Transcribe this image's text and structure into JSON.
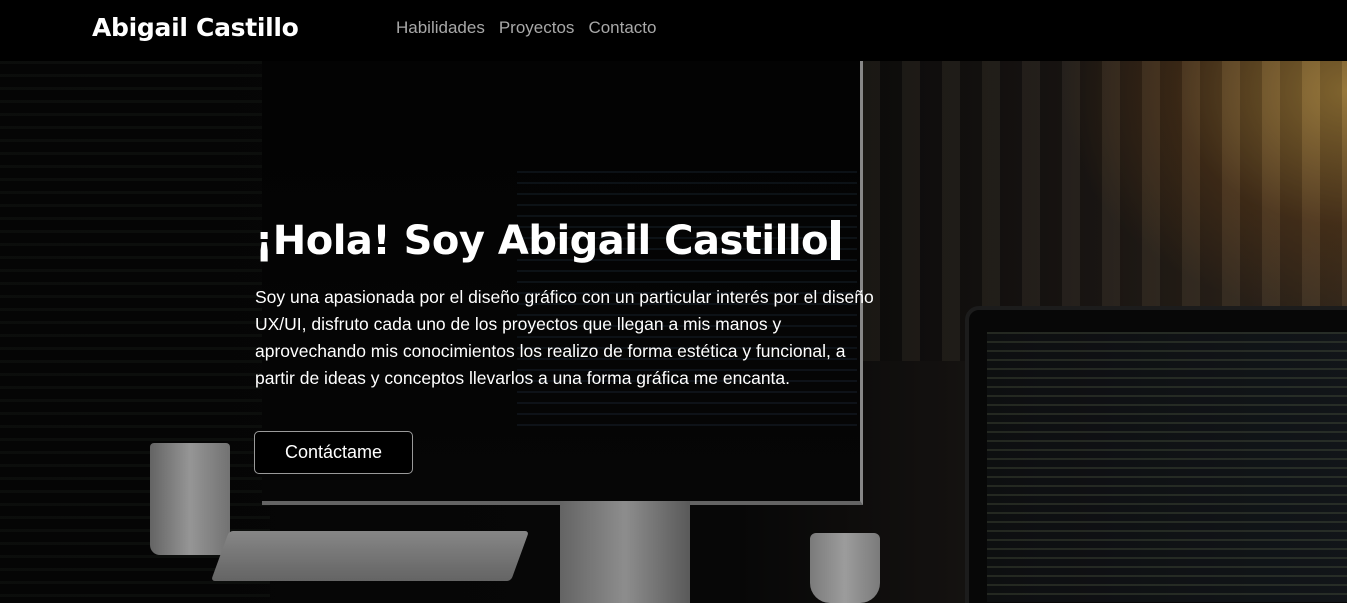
{
  "navbar": {
    "brand": "Abigail Castillo",
    "links": [
      {
        "label": "Habilidades"
      },
      {
        "label": "Proyectos"
      },
      {
        "label": "Contacto"
      }
    ]
  },
  "hero": {
    "title": "¡Hola! Soy Abigail Castillo",
    "description": "Soy una apasionada por el diseño gráfico con un particular interés por el diseño UX/UI, disfruto cada uno de los proyectos que llegan a mis manos y aprovechando mis conocimientos los realizo de forma estética y funcional, a partir de ideas y conceptos llevarlos a una forma gráfica me encanta.",
    "cta_label": "Contáctame"
  },
  "colors": {
    "navbar_background": "#000000",
    "nav_link": "#a8a8a8",
    "text": "#ffffff",
    "button_border": "#9a9a9a"
  }
}
